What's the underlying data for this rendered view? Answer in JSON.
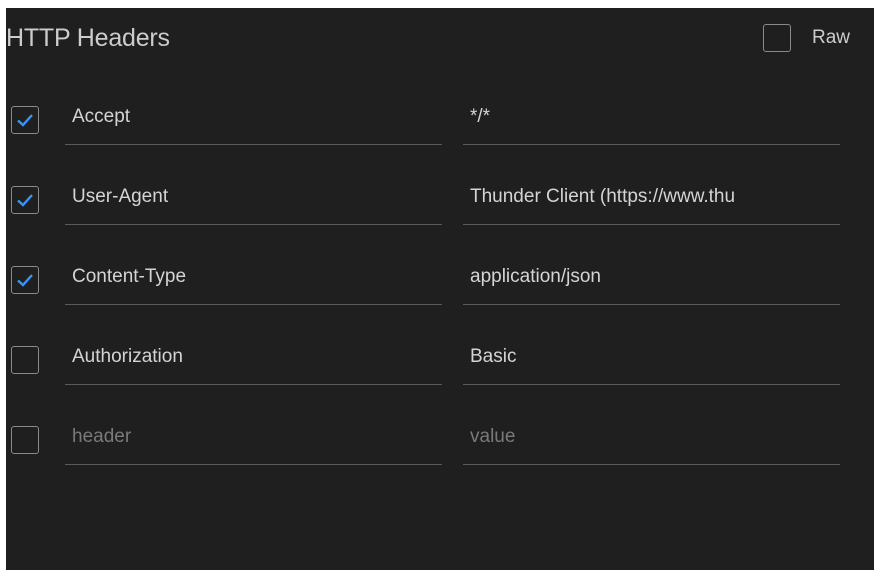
{
  "panel": {
    "title": "HTTP Headers",
    "raw": {
      "label": "Raw",
      "checked": false
    }
  },
  "headers": [
    {
      "enabled": true,
      "name": "Accept",
      "value": "*/*"
    },
    {
      "enabled": true,
      "name": "User-Agent",
      "value": "Thunder Client (https://www.thu"
    },
    {
      "enabled": true,
      "name": "Content-Type",
      "value": "application/json"
    },
    {
      "enabled": false,
      "name": "Authorization",
      "value": "Basic"
    }
  ],
  "new_header": {
    "enabled": false,
    "name_placeholder": "header",
    "value_placeholder": "value"
  },
  "colors": {
    "background": "#1f1f1f",
    "checkmark": "#3794ff",
    "checkbox_border": "#8a8a8a",
    "underline": "#5a5a5a",
    "text": "#d4d4d4",
    "placeholder": "#7a7a7a"
  }
}
